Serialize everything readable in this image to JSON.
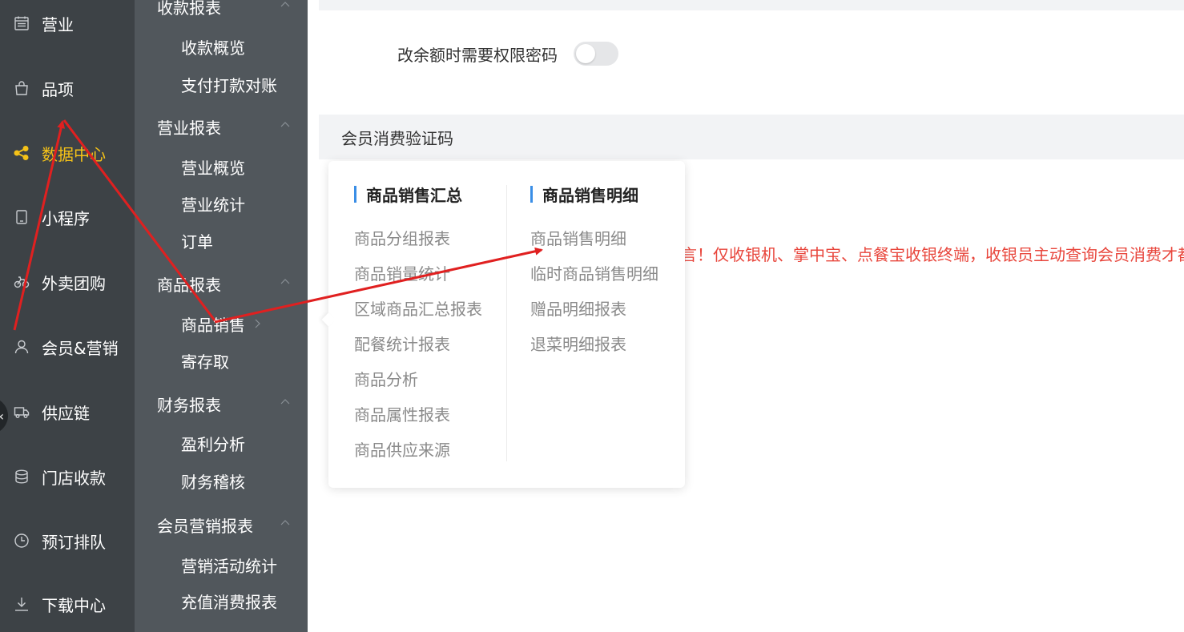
{
  "nav_primary": [
    {
      "label": "营业",
      "icon": "calendar-icon",
      "active": false
    },
    {
      "label": "品项",
      "icon": "bag-icon",
      "active": false
    },
    {
      "label": "数据中心",
      "icon": "share-icon",
      "active": true
    },
    {
      "label": "小程序",
      "icon": "phone-icon",
      "active": false
    },
    {
      "label": "外卖团购",
      "icon": "bike-icon",
      "active": false
    },
    {
      "label": "会员&营销",
      "icon": "user-icon",
      "active": false
    },
    {
      "label": "供应链",
      "icon": "truck-icon",
      "active": false
    },
    {
      "label": "门店收款",
      "icon": "database-icon",
      "active": false
    },
    {
      "label": "预订排队",
      "icon": "clock-icon",
      "active": false
    },
    {
      "label": "下载中心",
      "icon": "download-icon",
      "active": false
    }
  ],
  "nav_secondary": {
    "groups": [
      {
        "label": "收款报表",
        "items": [
          "收款概览",
          "支付打款对账"
        ]
      },
      {
        "label": "营业报表",
        "items": [
          "营业概览",
          "营业统计",
          "订单"
        ]
      },
      {
        "label": "商品报表",
        "items": [
          "商品销售",
          "寄存取"
        ]
      },
      {
        "label": "财务报表",
        "items": [
          "盈利分析",
          "财务稽核"
        ]
      },
      {
        "label": "会员营销报表",
        "items": [
          "营销活动统计",
          "充值消费报表"
        ]
      }
    ]
  },
  "main": {
    "setting_label": "改余额时需要权限密码",
    "section_title": "会员消费验证码",
    "warning_text": "言！仅收银机、掌中宝、点餐宝收银终端，收银员主动查询会员消费才都"
  },
  "popup": {
    "left_title": "商品销售汇总",
    "left_items": [
      "商品分组报表",
      "商品销量统计",
      "区域商品汇总报表",
      "配餐统计报表",
      "商品分析",
      "商品属性报表",
      "商品供应来源"
    ],
    "right_title": "商品销售明细",
    "right_items": [
      "商品销售明细",
      "临时商品销售明细",
      "赠品明细报表",
      "退菜明细报表"
    ]
  },
  "colors": {
    "nav_primary_bg": "#3d4246",
    "nav_secondary_bg": "#51575c",
    "active": "#f5c218",
    "accent": "#3a8ee6",
    "warning": "#e8463c",
    "annotation": "#e02020"
  }
}
